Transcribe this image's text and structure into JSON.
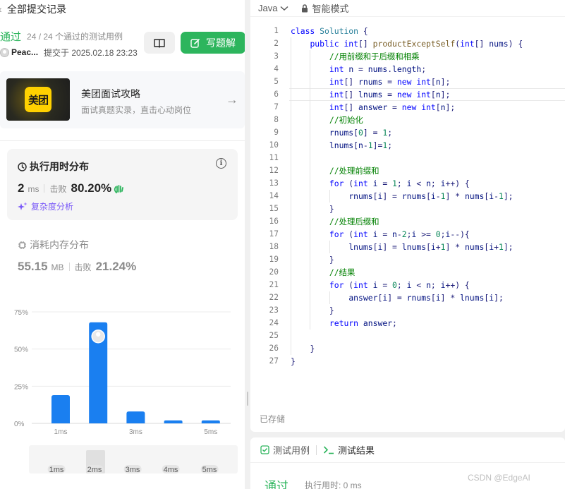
{
  "left_panel": {
    "header_title": "全部提交记录",
    "status": "通过",
    "test_count": "24 / 24 个通过的测试用例",
    "user_name": "Peac...",
    "submitted_at": "提交于 2025.02.18 23:23",
    "write_button": "写题解"
  },
  "ad": {
    "logo_text": "美团",
    "title": "美团面试攻略",
    "subtitle": "面试真题实录，直击心动岗位"
  },
  "runtime": {
    "title": "执行用时分布",
    "value": "2",
    "unit": "ms",
    "beat_label": "击败",
    "beat_pct": "80.20%",
    "analysis_label": "复杂度分析"
  },
  "memory": {
    "title": "消耗内存分布",
    "value": "55.15",
    "unit": "MB",
    "beat_label": "击败",
    "beat_pct": "21.24%"
  },
  "chart_data": {
    "type": "bar",
    "categories": [
      "1ms",
      "2ms",
      "3ms",
      "4ms",
      "5ms"
    ],
    "x_tick_labels": [
      "1ms",
      "",
      "3ms",
      "",
      "5ms"
    ],
    "values": [
      19,
      68,
      8,
      2,
      2
    ],
    "ylim": [
      0,
      75
    ],
    "y_ticks": [
      0,
      25,
      50,
      75
    ],
    "y_tick_labels": [
      "0%",
      "25%",
      "50%",
      "75%"
    ],
    "highlight_index": 1,
    "bar_color": "#1a7ff0",
    "grid": true
  },
  "range_labels": [
    "1ms",
    "2ms",
    "3ms",
    "4ms",
    "5ms"
  ],
  "editor": {
    "language": "Java",
    "mode": "智能模式",
    "saved": "已存储",
    "highlight_line": 6,
    "lines": [
      {
        "n": "1",
        "indent": 0,
        "tokens": [
          [
            "kw",
            "class"
          ],
          [
            "t",
            " "
          ],
          [
            "ty",
            "Solution"
          ],
          [
            "t",
            " {"
          ]
        ]
      },
      {
        "n": "2",
        "indent": 1,
        "tokens": [
          [
            "kw",
            "public"
          ],
          [
            "t",
            " "
          ],
          [
            "kw",
            "int"
          ],
          [
            "t",
            "[] "
          ],
          [
            "fn",
            "productExceptSelf"
          ],
          [
            "t",
            "("
          ],
          [
            "kw",
            "int"
          ],
          [
            "t",
            "[] "
          ],
          [
            "pl",
            "nums"
          ],
          [
            "t",
            ") {"
          ]
        ]
      },
      {
        "n": "3",
        "indent": 2,
        "tokens": [
          [
            "cm",
            "//用前缀和于后缀和相乘"
          ]
        ]
      },
      {
        "n": "4",
        "indent": 2,
        "tokens": [
          [
            "kw",
            "int"
          ],
          [
            "t",
            " "
          ],
          [
            "pl",
            "n"
          ],
          [
            "t",
            " = "
          ],
          [
            "pl",
            "nums"
          ],
          [
            "t",
            "."
          ],
          [
            "pl",
            "length"
          ],
          [
            "t",
            ";"
          ]
        ]
      },
      {
        "n": "5",
        "indent": 2,
        "tokens": [
          [
            "kw",
            "int"
          ],
          [
            "t",
            "[] "
          ],
          [
            "pl",
            "rnums"
          ],
          [
            "t",
            " = "
          ],
          [
            "kw",
            "new"
          ],
          [
            "t",
            " "
          ],
          [
            "kw",
            "int"
          ],
          [
            "t",
            "["
          ],
          [
            "pl",
            "n"
          ],
          [
            "t",
            "];"
          ]
        ]
      },
      {
        "n": "6",
        "indent": 2,
        "tokens": [
          [
            "kw",
            "int"
          ],
          [
            "t",
            "[] "
          ],
          [
            "pl",
            "lnums"
          ],
          [
            "t",
            " = "
          ],
          [
            "kw",
            "new"
          ],
          [
            "t",
            " "
          ],
          [
            "kw",
            "int"
          ],
          [
            "t",
            "["
          ],
          [
            "pl",
            "n"
          ],
          [
            "t",
            "];"
          ]
        ]
      },
      {
        "n": "7",
        "indent": 2,
        "tokens": [
          [
            "kw",
            "int"
          ],
          [
            "t",
            "[] "
          ],
          [
            "pl",
            "answer"
          ],
          [
            "t",
            " = "
          ],
          [
            "kw",
            "new"
          ],
          [
            "t",
            " "
          ],
          [
            "kw",
            "int"
          ],
          [
            "t",
            "["
          ],
          [
            "pl",
            "n"
          ],
          [
            "t",
            "];"
          ]
        ]
      },
      {
        "n": "8",
        "indent": 2,
        "tokens": [
          [
            "cm",
            "//初始化"
          ]
        ]
      },
      {
        "n": "9",
        "indent": 2,
        "tokens": [
          [
            "pl",
            "rnums"
          ],
          [
            "t",
            "["
          ],
          [
            "num",
            "0"
          ],
          [
            "t",
            "] = "
          ],
          [
            "num",
            "1"
          ],
          [
            "t",
            ";"
          ]
        ]
      },
      {
        "n": "10",
        "indent": 2,
        "tokens": [
          [
            "pl",
            "lnums"
          ],
          [
            "t",
            "["
          ],
          [
            "pl",
            "n"
          ],
          [
            "t",
            "-"
          ],
          [
            "num",
            "1"
          ],
          [
            "t",
            "]="
          ],
          [
            "num",
            "1"
          ],
          [
            "t",
            ";"
          ]
        ]
      },
      {
        "n": "11",
        "indent": 0,
        "tokens": []
      },
      {
        "n": "12",
        "indent": 2,
        "tokens": [
          [
            "cm",
            "//处理前缀和"
          ]
        ]
      },
      {
        "n": "13",
        "indent": 2,
        "tokens": [
          [
            "kw",
            "for"
          ],
          [
            "t",
            " ("
          ],
          [
            "kw",
            "int"
          ],
          [
            "t",
            " "
          ],
          [
            "pl",
            "i"
          ],
          [
            "t",
            " = "
          ],
          [
            "num",
            "1"
          ],
          [
            "t",
            "; "
          ],
          [
            "pl",
            "i"
          ],
          [
            "t",
            " < "
          ],
          [
            "pl",
            "n"
          ],
          [
            "t",
            "; "
          ],
          [
            "pl",
            "i"
          ],
          [
            "t",
            "++) {"
          ]
        ]
      },
      {
        "n": "14",
        "indent": 3,
        "tokens": [
          [
            "pl",
            "rnums"
          ],
          [
            "t",
            "["
          ],
          [
            "pl",
            "i"
          ],
          [
            "t",
            "] = "
          ],
          [
            "pl",
            "rnums"
          ],
          [
            "t",
            "["
          ],
          [
            "pl",
            "i"
          ],
          [
            "t",
            "-"
          ],
          [
            "num",
            "1"
          ],
          [
            "t",
            "] * "
          ],
          [
            "pl",
            "nums"
          ],
          [
            "t",
            "["
          ],
          [
            "pl",
            "i"
          ],
          [
            "t",
            "-"
          ],
          [
            "num",
            "1"
          ],
          [
            "t",
            "];"
          ]
        ]
      },
      {
        "n": "15",
        "indent": 2,
        "tokens": [
          [
            "t",
            "}"
          ]
        ]
      },
      {
        "n": "16",
        "indent": 2,
        "tokens": [
          [
            "cm",
            "//处理后缀和"
          ]
        ]
      },
      {
        "n": "17",
        "indent": 2,
        "tokens": [
          [
            "kw",
            "for"
          ],
          [
            "t",
            " ("
          ],
          [
            "kw",
            "int"
          ],
          [
            "t",
            " "
          ],
          [
            "pl",
            "i"
          ],
          [
            "t",
            " = "
          ],
          [
            "pl",
            "n"
          ],
          [
            "t",
            "-"
          ],
          [
            "num",
            "2"
          ],
          [
            "t",
            ";"
          ],
          [
            "pl",
            "i"
          ],
          [
            "t",
            " >= "
          ],
          [
            "num",
            "0"
          ],
          [
            "t",
            ";"
          ],
          [
            "pl",
            "i"
          ],
          [
            "t",
            "--){"
          ]
        ]
      },
      {
        "n": "18",
        "indent": 3,
        "tokens": [
          [
            "pl",
            "lnums"
          ],
          [
            "t",
            "["
          ],
          [
            "pl",
            "i"
          ],
          [
            "t",
            "] = "
          ],
          [
            "pl",
            "lnums"
          ],
          [
            "t",
            "["
          ],
          [
            "pl",
            "i"
          ],
          [
            "t",
            "+"
          ],
          [
            "num",
            "1"
          ],
          [
            "t",
            "] * "
          ],
          [
            "pl",
            "nums"
          ],
          [
            "t",
            "["
          ],
          [
            "pl",
            "i"
          ],
          [
            "t",
            "+"
          ],
          [
            "num",
            "1"
          ],
          [
            "t",
            "];"
          ]
        ]
      },
      {
        "n": "19",
        "indent": 2,
        "tokens": [
          [
            "t",
            "}"
          ]
        ]
      },
      {
        "n": "20",
        "indent": 2,
        "tokens": [
          [
            "cm",
            "//结果"
          ]
        ]
      },
      {
        "n": "21",
        "indent": 2,
        "tokens": [
          [
            "kw",
            "for"
          ],
          [
            "t",
            " ("
          ],
          [
            "kw",
            "int"
          ],
          [
            "t",
            " "
          ],
          [
            "pl",
            "i"
          ],
          [
            "t",
            " = "
          ],
          [
            "num",
            "0"
          ],
          [
            "t",
            "; "
          ],
          [
            "pl",
            "i"
          ],
          [
            "t",
            " < "
          ],
          [
            "pl",
            "n"
          ],
          [
            "t",
            "; "
          ],
          [
            "pl",
            "i"
          ],
          [
            "t",
            "++) {"
          ]
        ]
      },
      {
        "n": "22",
        "indent": 3,
        "tokens": [
          [
            "pl",
            "answer"
          ],
          [
            "t",
            "["
          ],
          [
            "pl",
            "i"
          ],
          [
            "t",
            "] = "
          ],
          [
            "pl",
            "rnums"
          ],
          [
            "t",
            "["
          ],
          [
            "pl",
            "i"
          ],
          [
            "t",
            "] * "
          ],
          [
            "pl",
            "lnums"
          ],
          [
            "t",
            "["
          ],
          [
            "pl",
            "i"
          ],
          [
            "t",
            "];"
          ]
        ]
      },
      {
        "n": "23",
        "indent": 2,
        "tokens": [
          [
            "t",
            "}"
          ]
        ]
      },
      {
        "n": "24",
        "indent": 2,
        "tokens": [
          [
            "kw",
            "return"
          ],
          [
            "t",
            " "
          ],
          [
            "pl",
            "answer"
          ],
          [
            "t",
            ";"
          ]
        ]
      },
      {
        "n": "25",
        "indent": 0,
        "tokens": []
      },
      {
        "n": "26",
        "indent": 1,
        "tokens": [
          [
            "t",
            "}"
          ]
        ]
      },
      {
        "n": "27",
        "indent": 0,
        "tokens": [
          [
            "t",
            "}"
          ]
        ]
      }
    ]
  },
  "bottom_panel": {
    "tab_testcase": "测试用例",
    "tab_result": "测试结果",
    "result_status": "通过",
    "result_time": "执行用时: 0 ms"
  },
  "watermark": "CSDN @EdgeAI",
  "colors": {
    "accent_green": "#2db55d",
    "bar_blue": "#1a7ff0",
    "analysis_purple": "#7a5af8"
  },
  "icons": [
    "chevron-left-icon",
    "book-icon",
    "edit-icon",
    "arrow-right-icon",
    "clock-icon",
    "info-icon",
    "wave-hand-icon",
    "sparkle-icon",
    "memory-chip-icon",
    "chevron-down-icon",
    "lock-icon",
    "checkbox-icon",
    "terminal-icon",
    "avatar"
  ]
}
